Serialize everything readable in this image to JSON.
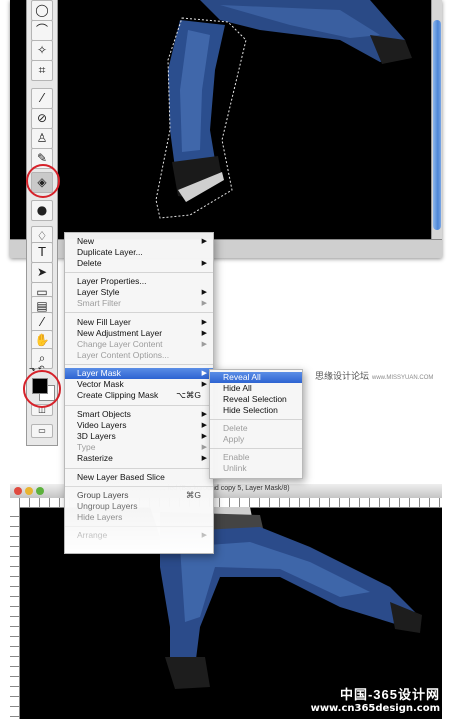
{
  "context_menu": {
    "items": [
      {
        "label": "New",
        "submenu": true,
        "enabled": true
      },
      {
        "label": "Duplicate Layer...",
        "submenu": false,
        "enabled": true
      },
      {
        "label": "Delete",
        "submenu": true,
        "enabled": true
      },
      {
        "label": "Layer Properties...",
        "submenu": false,
        "enabled": true
      },
      {
        "label": "Layer Style",
        "submenu": true,
        "enabled": true
      },
      {
        "label": "Smart Filter",
        "submenu": true,
        "enabled": false
      },
      {
        "label": "New Fill Layer",
        "submenu": true,
        "enabled": true
      },
      {
        "label": "New Adjustment Layer",
        "submenu": true,
        "enabled": true
      },
      {
        "label": "Change Layer Content",
        "submenu": true,
        "enabled": false
      },
      {
        "label": "Layer Content Options...",
        "submenu": false,
        "enabled": false
      },
      {
        "label": "Layer Mask",
        "submenu": true,
        "enabled": true,
        "highlighted": true
      },
      {
        "label": "Vector Mask",
        "submenu": true,
        "enabled": true
      },
      {
        "label": "Create Clipping Mask",
        "shortcut": "⌥⌘G",
        "enabled": true
      },
      {
        "label": "Smart Objects",
        "submenu": true,
        "enabled": true
      },
      {
        "label": "Video Layers",
        "submenu": true,
        "enabled": true
      },
      {
        "label": "3D Layers",
        "submenu": true,
        "enabled": true
      },
      {
        "label": "Type",
        "submenu": true,
        "enabled": false
      },
      {
        "label": "Rasterize",
        "submenu": true,
        "enabled": true
      },
      {
        "label": "New Layer Based Slice",
        "enabled": true
      },
      {
        "label": "Group Layers",
        "shortcut": "⌘G",
        "enabled": true
      },
      {
        "label": "Ungroup Layers",
        "enabled": true
      },
      {
        "label": "Hide Layers",
        "enabled": true
      },
      {
        "label": "Arrange",
        "enabled": true
      }
    ]
  },
  "layer_mask_submenu": {
    "items": [
      {
        "label": "Reveal All",
        "enabled": true,
        "highlighted": true
      },
      {
        "label": "Hide All",
        "enabled": true
      },
      {
        "label": "Reveal Selection",
        "enabled": true
      },
      {
        "label": "Hide Selection",
        "enabled": true
      },
      {
        "label": "Delete",
        "enabled": false
      },
      {
        "label": "Apply",
        "enabled": false
      },
      {
        "label": "Enable",
        "enabled": false
      },
      {
        "label": "Unlink",
        "enabled": false
      }
    ]
  },
  "toolbox": {
    "tools": [
      "marquee-icon",
      "lasso-icon",
      "magic-wand-icon",
      "crop-icon",
      "eyedropper-icon",
      "healing-brush-icon",
      "brush-icon",
      "clone-stamp-icon",
      "history-brush-icon",
      "eraser-icon",
      "paint-bucket-icon",
      "blur-icon",
      "dodge-icon",
      "pen-icon",
      "type-icon",
      "path-select-icon",
      "shape-icon",
      "notes-icon",
      "eyedropper2-icon",
      "hand-icon",
      "zoom-icon"
    ],
    "type_tool_glyph": "T",
    "foreground_color": "#000000",
    "background_color": "#ffffff"
  },
  "bottom_window": {
    "title": "... ied (Background copy 5, Layer Mask/8)"
  },
  "watermarks": {
    "top_chinese": "思缘设计论坛",
    "top_url": "www.MISSYUAN.COM",
    "bottom_chinese": "中国-365设计网",
    "bottom_url": "www.cn365design.com"
  },
  "colors": {
    "highlight": "#2d63d1",
    "annotation_ring": "#d6222a",
    "canvas": "#000000"
  }
}
